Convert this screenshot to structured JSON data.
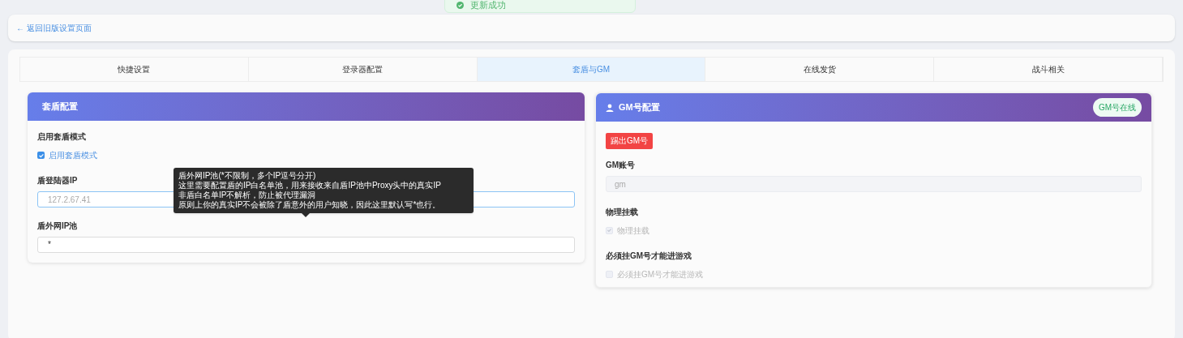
{
  "toast": {
    "message": "更新成功"
  },
  "back_link": {
    "label": "← 返回旧版设置页面"
  },
  "tabs": [
    {
      "label": "快捷设置",
      "selected": false
    },
    {
      "label": "登录器配置",
      "selected": false
    },
    {
      "label": "套盾与GM",
      "selected": true
    },
    {
      "label": "在线发货",
      "selected": false
    },
    {
      "label": "战斗相关",
      "selected": false
    }
  ],
  "shield_panel": {
    "title": "套盾配置",
    "enable_label": "启用套盾模式",
    "enable_checkbox": {
      "label": "启用套盾模式",
      "checked": true
    },
    "login_ip_label": "盾登陆器IP",
    "login_ip_placeholder": "127.2.67.41",
    "ip_pool_label": "盾外网IP池",
    "ip_pool_value": "*",
    "tooltip": [
      "盾外网IP池(*不限制，多个IP逗号分开)",
      "这里需要配置盾的IP白名单池，用来接收来自盾IP池中Proxy头中的真实IP",
      "非盾白名单IP不解析，防止被代理漏洞",
      "原则上你的真实IP不会被除了盾意外的用户知晓，因此这里默认写*也行。"
    ]
  },
  "gm_panel": {
    "title": "GM号配置",
    "status_badge": "GM号在线",
    "logout_button": "踢出GM号",
    "account_label": "GM账号",
    "account_value": "gm",
    "options": [
      {
        "heading": "物理挂载",
        "label": "物理挂载",
        "checked": true,
        "disabled": true
      },
      {
        "heading": "必须挂GM号才能进游戏",
        "label": "必须挂GM号才能进游戏",
        "checked": false,
        "disabled": true
      }
    ]
  }
}
